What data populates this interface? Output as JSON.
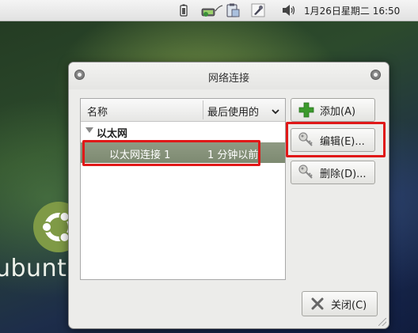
{
  "panel": {
    "clock": "1月26日星期二 16:50"
  },
  "desktop": {
    "brand_word": "ubuntu"
  },
  "dialog": {
    "title": "网络连接",
    "columns": {
      "name": "名称",
      "last_used": "最后使用的"
    },
    "group": {
      "label": "以太网"
    },
    "connection": {
      "name": "以太网连接 1",
      "last_used": "1 分钟以前"
    },
    "buttons": {
      "add": "添加(A)",
      "edit": "编辑(E)...",
      "delete": "删除(D)...",
      "close": "关闭(C)"
    }
  },
  "icons": {
    "panel": [
      "battery-icon",
      "network-icon",
      "clipboard-icon",
      "bookmark-icon",
      "volume-icon"
    ],
    "window": [
      "window-close-icon",
      "window-menu-icon"
    ],
    "add": "plus-icon",
    "edit": "key-icon",
    "delete": "key-icon",
    "close": "close-x-icon"
  },
  "colors": {
    "selection": "#849077",
    "highlight_box": "#e01818",
    "add_icon": "#3c9a2c",
    "ubuntu_logo": "#7f9a46"
  }
}
